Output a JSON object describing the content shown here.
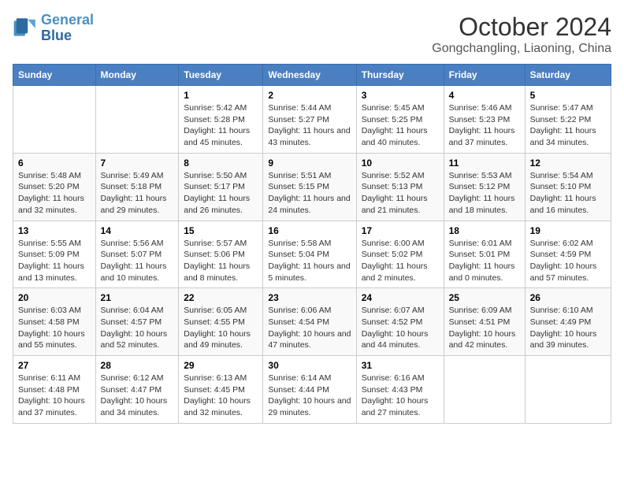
{
  "logo": {
    "line1": "General",
    "line2": "Blue"
  },
  "title": "October 2024",
  "subtitle": "Gongchangling, Liaoning, China",
  "days_of_week": [
    "Sunday",
    "Monday",
    "Tuesday",
    "Wednesday",
    "Thursday",
    "Friday",
    "Saturday"
  ],
  "weeks": [
    [
      {
        "day": "",
        "info": ""
      },
      {
        "day": "",
        "info": ""
      },
      {
        "day": "1",
        "sunrise": "5:42 AM",
        "sunset": "5:28 PM",
        "daylight": "11 hours and 45 minutes."
      },
      {
        "day": "2",
        "sunrise": "5:44 AM",
        "sunset": "5:27 PM",
        "daylight": "11 hours and 43 minutes."
      },
      {
        "day": "3",
        "sunrise": "5:45 AM",
        "sunset": "5:25 PM",
        "daylight": "11 hours and 40 minutes."
      },
      {
        "day": "4",
        "sunrise": "5:46 AM",
        "sunset": "5:23 PM",
        "daylight": "11 hours and 37 minutes."
      },
      {
        "day": "5",
        "sunrise": "5:47 AM",
        "sunset": "5:22 PM",
        "daylight": "11 hours and 34 minutes."
      }
    ],
    [
      {
        "day": "6",
        "sunrise": "5:48 AM",
        "sunset": "5:20 PM",
        "daylight": "11 hours and 32 minutes."
      },
      {
        "day": "7",
        "sunrise": "5:49 AM",
        "sunset": "5:18 PM",
        "daylight": "11 hours and 29 minutes."
      },
      {
        "day": "8",
        "sunrise": "5:50 AM",
        "sunset": "5:17 PM",
        "daylight": "11 hours and 26 minutes."
      },
      {
        "day": "9",
        "sunrise": "5:51 AM",
        "sunset": "5:15 PM",
        "daylight": "11 hours and 24 minutes."
      },
      {
        "day": "10",
        "sunrise": "5:52 AM",
        "sunset": "5:13 PM",
        "daylight": "11 hours and 21 minutes."
      },
      {
        "day": "11",
        "sunrise": "5:53 AM",
        "sunset": "5:12 PM",
        "daylight": "11 hours and 18 minutes."
      },
      {
        "day": "12",
        "sunrise": "5:54 AM",
        "sunset": "5:10 PM",
        "daylight": "11 hours and 16 minutes."
      }
    ],
    [
      {
        "day": "13",
        "sunrise": "5:55 AM",
        "sunset": "5:09 PM",
        "daylight": "11 hours and 13 minutes."
      },
      {
        "day": "14",
        "sunrise": "5:56 AM",
        "sunset": "5:07 PM",
        "daylight": "11 hours and 10 minutes."
      },
      {
        "day": "15",
        "sunrise": "5:57 AM",
        "sunset": "5:06 PM",
        "daylight": "11 hours and 8 minutes."
      },
      {
        "day": "16",
        "sunrise": "5:58 AM",
        "sunset": "5:04 PM",
        "daylight": "11 hours and 5 minutes."
      },
      {
        "day": "17",
        "sunrise": "6:00 AM",
        "sunset": "5:02 PM",
        "daylight": "11 hours and 2 minutes."
      },
      {
        "day": "18",
        "sunrise": "6:01 AM",
        "sunset": "5:01 PM",
        "daylight": "11 hours and 0 minutes."
      },
      {
        "day": "19",
        "sunrise": "6:02 AM",
        "sunset": "4:59 PM",
        "daylight": "10 hours and 57 minutes."
      }
    ],
    [
      {
        "day": "20",
        "sunrise": "6:03 AM",
        "sunset": "4:58 PM",
        "daylight": "10 hours and 55 minutes."
      },
      {
        "day": "21",
        "sunrise": "6:04 AM",
        "sunset": "4:57 PM",
        "daylight": "10 hours and 52 minutes."
      },
      {
        "day": "22",
        "sunrise": "6:05 AM",
        "sunset": "4:55 PM",
        "daylight": "10 hours and 49 minutes."
      },
      {
        "day": "23",
        "sunrise": "6:06 AM",
        "sunset": "4:54 PM",
        "daylight": "10 hours and 47 minutes."
      },
      {
        "day": "24",
        "sunrise": "6:07 AM",
        "sunset": "4:52 PM",
        "daylight": "10 hours and 44 minutes."
      },
      {
        "day": "25",
        "sunrise": "6:09 AM",
        "sunset": "4:51 PM",
        "daylight": "10 hours and 42 minutes."
      },
      {
        "day": "26",
        "sunrise": "6:10 AM",
        "sunset": "4:49 PM",
        "daylight": "10 hours and 39 minutes."
      }
    ],
    [
      {
        "day": "27",
        "sunrise": "6:11 AM",
        "sunset": "4:48 PM",
        "daylight": "10 hours and 37 minutes."
      },
      {
        "day": "28",
        "sunrise": "6:12 AM",
        "sunset": "4:47 PM",
        "daylight": "10 hours and 34 minutes."
      },
      {
        "day": "29",
        "sunrise": "6:13 AM",
        "sunset": "4:45 PM",
        "daylight": "10 hours and 32 minutes."
      },
      {
        "day": "30",
        "sunrise": "6:14 AM",
        "sunset": "4:44 PM",
        "daylight": "10 hours and 29 minutes."
      },
      {
        "day": "31",
        "sunrise": "6:16 AM",
        "sunset": "4:43 PM",
        "daylight": "10 hours and 27 minutes."
      },
      {
        "day": "",
        "info": ""
      },
      {
        "day": "",
        "info": ""
      }
    ]
  ]
}
